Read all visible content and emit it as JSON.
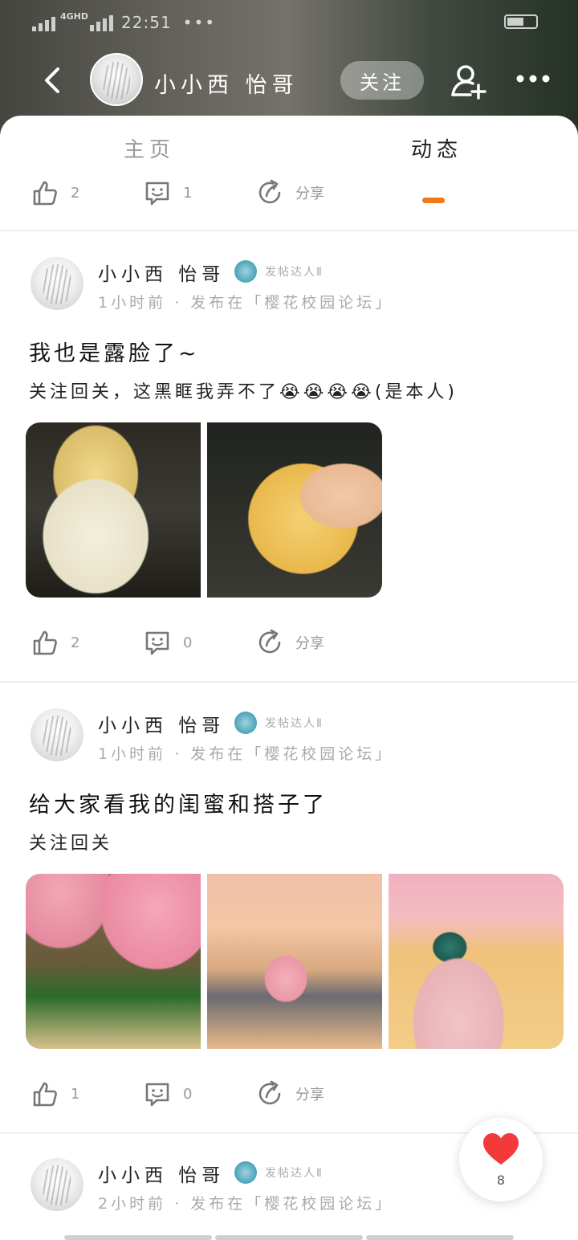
{
  "status_bar": {
    "network": "4GHD",
    "time": "22:51"
  },
  "header": {
    "name": "小小西  怡哥",
    "follow_label": "关注"
  },
  "tabs": [
    {
      "label": "主页",
      "active": false
    },
    {
      "label": "动态",
      "active": true
    }
  ],
  "top_actions": {
    "likes": "2",
    "comments": "1",
    "share_label": "分享"
  },
  "posts": [
    {
      "author": "小小西  怡哥",
      "badge": "发帖达人Ⅱ",
      "meta": "1小时前 · 发布在「樱花校园论坛」",
      "title": "我也是露脸了~",
      "body": "关注回关，这黑眶我弄不了😭😭😭😭(是本人)",
      "likes": "2",
      "comments": "0",
      "share_label": "分享"
    },
    {
      "author": "小小西  怡哥",
      "badge": "发帖达人Ⅱ",
      "meta": "1小时前 · 发布在「樱花校园论坛」",
      "title": "给大家看我的闺蜜和搭子了",
      "body": "关注回关",
      "likes": "1",
      "comments": "0",
      "share_label": "分享"
    },
    {
      "author": "小小西  怡哥",
      "badge": "发帖达人Ⅱ",
      "meta": "2小时前 · 发布在「樱花校园论坛」"
    }
  ],
  "floating_like": {
    "count": "8",
    "color": "#f23a3a"
  },
  "colors": {
    "accent": "#f07a1a",
    "muted": "#999999"
  }
}
